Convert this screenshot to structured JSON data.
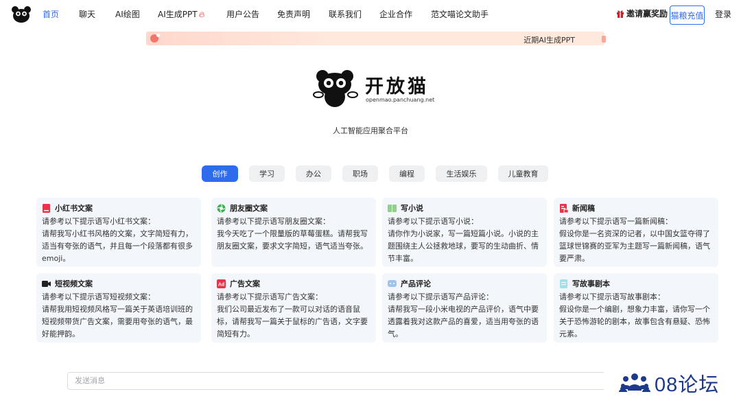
{
  "nav": {
    "items": [
      {
        "label": "首页",
        "active": true
      },
      {
        "label": "聊天"
      },
      {
        "label": "AI绘图"
      },
      {
        "label": "AI生成PPT"
      },
      {
        "label": "用户公告"
      },
      {
        "label": "免责声明"
      },
      {
        "label": "联系我们"
      },
      {
        "label": "企业合作"
      },
      {
        "label": "范文喵论文助手"
      }
    ],
    "invite_label": "邀请赢奖励",
    "recharge_label": "猫粮充值",
    "login_label": "登录"
  },
  "banner": {
    "text": "近期AI生成PPT"
  },
  "hero": {
    "brand_name": "开放猫",
    "brand_url": "openmao.panchuang.net",
    "tagline": "人工智能应用聚合平台"
  },
  "tabs": [
    {
      "label": "创作",
      "active": true
    },
    {
      "label": "学习"
    },
    {
      "label": "办公"
    },
    {
      "label": "职场"
    },
    {
      "label": "编程"
    },
    {
      "label": "生活娱乐"
    },
    {
      "label": "儿童教育"
    }
  ],
  "cards": [
    {
      "title": "小红书文案",
      "icon": "red-book-icon",
      "color": "#e8334a",
      "subtitle": "请参考以下提示语写小红书文案：",
      "body": "请帮我写小红书风格的文案，文字简短有力，适当有夸张的语气，并且每一个段落都有很多emoji。"
    },
    {
      "title": "朋友圈文案",
      "icon": "moments-icon",
      "color": "#38b24a",
      "subtitle": "请参考以下提示语写朋友圈文案：",
      "body": "我今天吃了一个限量版的草莓蛋糕。请帮我写朋友圈文案，要求文字简短，语气适当夸张。"
    },
    {
      "title": "写小说",
      "icon": "book-icon",
      "color": "#8fd18a",
      "subtitle": "请参考以下提示语写小说：",
      "body": "请你作为小说家，写一篇短篇小说。小说的主题围绕主人公拯救地球，要写的生动曲折、情节丰富。"
    },
    {
      "title": "新闻稿",
      "icon": "newspaper-icon",
      "color": "#e8334a",
      "subtitle": "请参考以下提示语写一篇新闻稿：",
      "body": "假设你是一名资深的记者，以中国女篮夺得了篮球世锦赛的亚军为主题写一篇新闻稿，语气要严肃。"
    },
    {
      "title": "短视频文案",
      "icon": "video-camera-icon",
      "color": "#222222",
      "subtitle": "请参考以下提示语写短视频文案：",
      "body": "请帮我用短视频风格写一篇关于英语培训班的短视频带货广告文案，需要用夸张的语气，最好能押韵。"
    },
    {
      "title": "广告文案",
      "icon": "ad-icon",
      "color": "#e8334a",
      "subtitle": "请参考以下提示语写广告文案：",
      "body": "我们公司最近发布了一款可以对话的语音鼠标，请帮我写一篇关于鼠标的广告语，文字要简短有力。"
    },
    {
      "title": "产品评论",
      "icon": "chat-bubble-icon",
      "color": "#9fc3ea",
      "subtitle": "请参考以下提示语写产品评论：",
      "body": "请帮我写一段小米电视的产品评价，语气中要透露着我对这款产品的喜爱，适当用夸张的语气。"
    },
    {
      "title": "写故事剧本",
      "icon": "script-icon",
      "color": "#9fe0ea",
      "subtitle": "请参考以下提示语写故事剧本：",
      "body": "假设你是一个编剧，想象力丰富，请你写一个关于恐怖游轮的剧本，故事包含有悬疑、恐怖元素。"
    }
  ],
  "chat": {
    "placeholder": "发送消息"
  },
  "watermark": {
    "text": "08论坛"
  }
}
